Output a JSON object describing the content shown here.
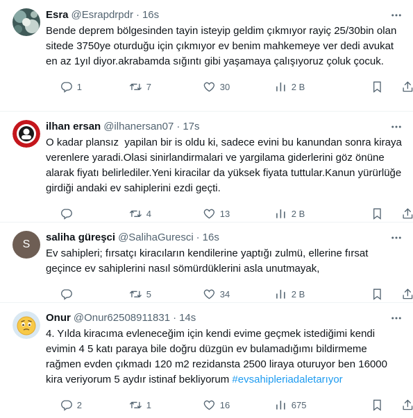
{
  "tweets": [
    {
      "name": "Esra",
      "handle": "@Esrapdrpdr",
      "separator": "·",
      "time": "16s",
      "text": "Bende deprem bölgesinden tayin isteyip geldim çıkmıyor rayiç 25/30bin olan sitede 3750ye oturduğu için çıkmıyor ev benim mahkemeye ver dedi avukat en az 1yıl diyor.akrabamda sığıntı gibi yaşamaya çalışıyoruz çoluk çocuk.",
      "hashtag": "",
      "replies": "1",
      "retweets": "7",
      "likes": "30",
      "views": "2 B"
    },
    {
      "name": "ilhan ersan",
      "handle": "@ilhanersan07",
      "separator": "·",
      "time": "17s",
      "text": "O kadar plansız  yapilan bir is oldu ki, sadece evini bu kanundan sonra kiraya verenlere yaradi.Olasi sinirlandirmalari ve yargilama giderlerini göz önüne alarak fiyatı belirlediler.Yeni kiracilar da yüksek fiyata tuttular.Kanun yürürlüğe girdiği andaki ev sahiplerini ezdi geçti.",
      "hashtag": "",
      "replies": "",
      "retweets": "4",
      "likes": "13",
      "views": "2 B"
    },
    {
      "name": "saliha güreşci",
      "handle": "@SalihaGuresci",
      "separator": "·",
      "time": "16s",
      "avatar_letter": "S",
      "text": "Ev sahipleri; fırsatçı kiracıların kendilerine yaptığı zulmü, ellerine fırsat geçince ev sahiplerini nasıl sömürdüklerini asla unutmayak,",
      "hashtag": "",
      "replies": "",
      "retweets": "5",
      "likes": "34",
      "views": "2 B"
    },
    {
      "name": "Onur",
      "handle": "@Onur62508911831",
      "separator": "·",
      "time": "14s",
      "text": "4. Yılda kiracıma evleneceğim için kendi evime geçmek istediğimi kendi evimin 4 5 katı paraya bile doğru düzgün ev bulamadığımı bildirmeme rağmen evden çıkmadı 120 m2 rezidansta 2500 liraya oturuyor ben 16000 kira veriyorum 5 aydır istinaf bekliyorum ",
      "hashtag": "#evsahipleriadaletarıyor",
      "replies": "2",
      "retweets": "1",
      "likes": "16",
      "views": "675"
    }
  ],
  "colors": {
    "secondary_text": "#536471",
    "link": "#1d9bf0",
    "divider": "#eff3f4",
    "saliha_avatar_bg": "#6e5e54"
  },
  "icons": [
    "reply-icon",
    "retweet-icon",
    "like-icon",
    "views-icon",
    "bookmark-icon",
    "share-icon",
    "more-icon"
  ]
}
